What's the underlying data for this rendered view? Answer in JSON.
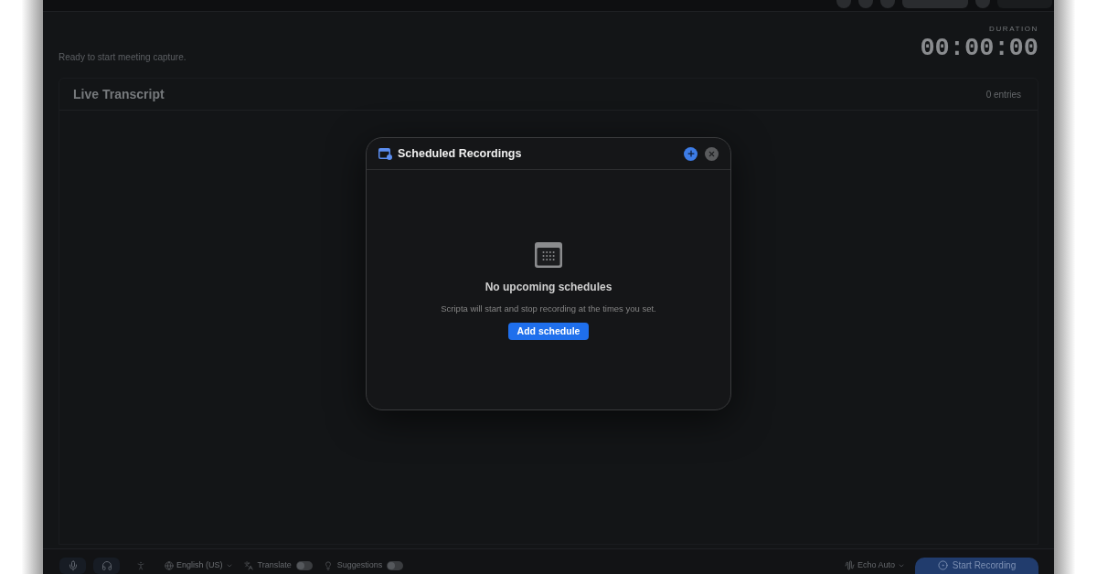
{
  "top_bar": {
    "controls": [
      {
        "kind": "circle"
      },
      {
        "kind": "circle"
      },
      {
        "kind": "circle"
      },
      {
        "kind": "pill"
      },
      {
        "kind": "circle"
      },
      {
        "kind": "wide"
      }
    ]
  },
  "status": {
    "text": "Ready to start meeting capture."
  },
  "duration": {
    "label": "DURATION",
    "value": "00:00:00"
  },
  "transcript": {
    "title": "Live Transcript",
    "count": "0 entries"
  },
  "modal": {
    "title": "Scheduled Recordings",
    "empty_title": "No upcoming schedules",
    "empty_text": "Scripta will start and stop recording at the times you set.",
    "action": "Add schedule"
  },
  "bottom_bar": {
    "sources": [
      {
        "kind": "mic",
        "selected": true
      },
      {
        "kind": "system",
        "selected": true
      },
      {
        "kind": "person",
        "selected": false
      }
    ],
    "language": "English (US)",
    "toggles": [
      {
        "kind": "translate",
        "label": "Translate",
        "on": false
      },
      {
        "kind": "suggestions",
        "label": "Suggestions",
        "on": false
      }
    ],
    "device": "Echo Auto",
    "record": "Start Recording"
  }
}
